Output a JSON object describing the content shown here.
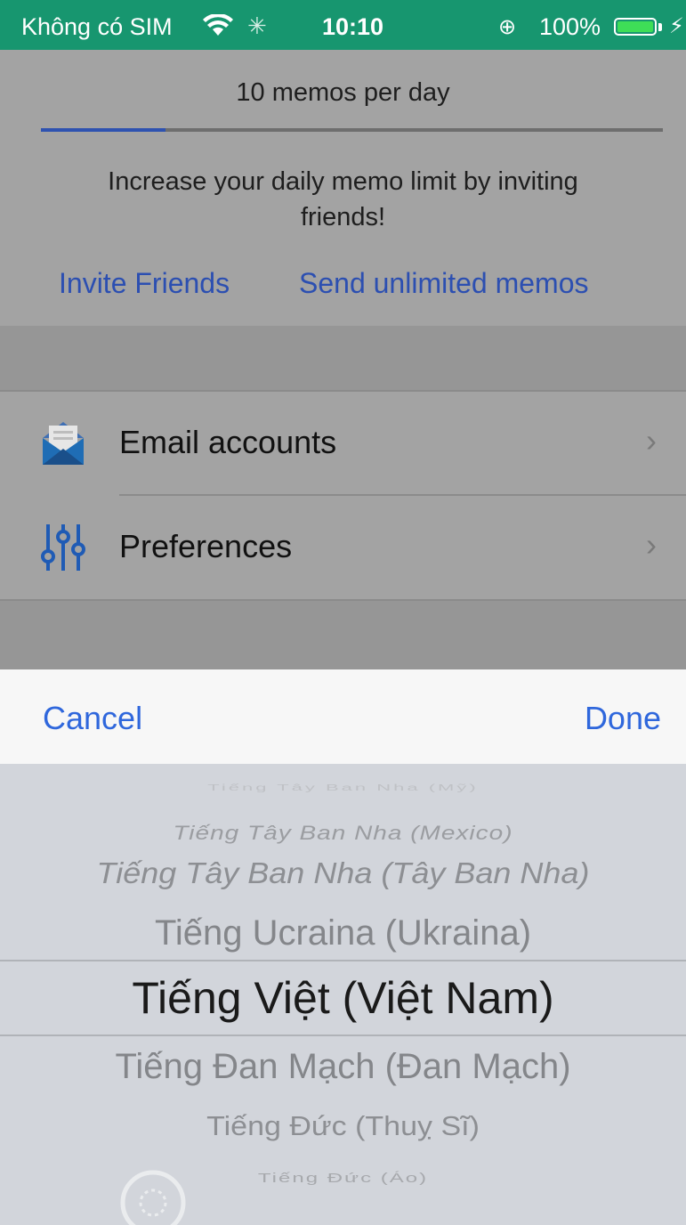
{
  "status_bar": {
    "carrier": "Không có SIM",
    "time": "10:10",
    "battery_percent": "100%",
    "battery_level": 1.0,
    "bg_color": "#17966f"
  },
  "quota": {
    "title": "10 memos per day",
    "progress": 0.2,
    "progress_color": "#2e52b0",
    "description": "Increase your daily memo limit by inviting friends!"
  },
  "links": {
    "invite": "Invite Friends",
    "unlimited": "Send unlimited memos",
    "color": "#2c4fb1"
  },
  "settings": {
    "rows": [
      {
        "label": "Email accounts",
        "icon": "email-envelope-icon"
      },
      {
        "label": "Preferences",
        "icon": "sliders-icon"
      }
    ]
  },
  "picker_toolbar": {
    "cancel": "Cancel",
    "done": "Done",
    "button_color": "#2f67dc"
  },
  "language_picker": {
    "options": [
      "Tiếng Tây Ban Nha (Mỹ)",
      "Tiếng Tây Ban Nha (Mexico)",
      "Tiếng Tây Ban Nha (Tây Ban Nha)",
      "Tiếng Ucraina (Ukraina)",
      "Tiếng Việt (Việt Nam)",
      "Tiếng Đan Mạch (Đan Mạch)",
      "Tiếng Đức (Thuỵ Sĩ)",
      "Tiếng Đức (Áo)"
    ],
    "selected": "Tiếng Việt (Việt Nam)"
  }
}
